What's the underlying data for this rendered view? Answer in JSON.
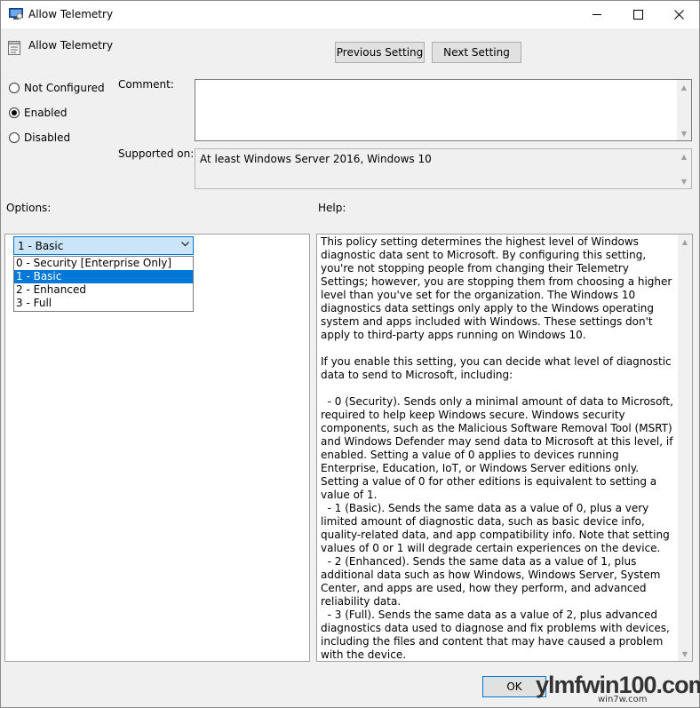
{
  "window": {
    "title": "Allow Telemetry"
  },
  "setting": {
    "name": "Allow Telemetry"
  },
  "nav": {
    "previous_label": "Previous Setting",
    "next_label": "Next Setting"
  },
  "state_options": [
    {
      "label": "Not Configured",
      "selected": false
    },
    {
      "label": "Enabled",
      "selected": true
    },
    {
      "label": "Disabled",
      "selected": false
    }
  ],
  "comment": {
    "label": "Comment:",
    "value": ""
  },
  "supported": {
    "label": "Supported on:",
    "value": "At least Windows Server 2016, Windows 10"
  },
  "options": {
    "label": "Options:",
    "combo_value": "1 - Basic",
    "items": [
      "0 - Security [Enterprise Only]",
      "1 - Basic",
      "2 - Enhanced",
      "3 - Full"
    ],
    "selected_index": 1
  },
  "help": {
    "label": "Help:",
    "text": "This policy setting determines the highest level of Windows diagnostic data sent to Microsoft. By configuring this setting, you're not stopping people from changing their Telemetry Settings; however, you are stopping them from choosing a higher level than you've set for the organization. The Windows 10 diagnostics data settings only apply to the Windows operating system and apps included with Windows. These settings don't apply to third-party apps running on Windows 10.\n\nIf you enable this setting, you can decide what level of diagnostic data to send to Microsoft, including:\n\n  - 0 (Security). Sends only a minimal amount of data to Microsoft, required to help keep Windows secure. Windows security components, such as the Malicious Software Removal Tool (MSRT) and Windows Defender may send data to Microsoft at this level, if enabled. Setting a value of 0 applies to devices running Enterprise, Education, IoT, or Windows Server editions only. Setting a value of 0 for other editions is equivalent to setting a value of 1.\n  - 1 (Basic). Sends the same data as a value of 0, plus a very limited amount of diagnostic data, such as basic device info, quality-related data, and app compatibility info. Note that setting values of 0 or 1 will degrade certain experiences on the device.\n  - 2 (Enhanced). Sends the same data as a value of 1, plus additional data such as how Windows, Windows Server, System Center, and apps are used, how they perform, and advanced reliability data.\n  - 3 (Full). Sends the same data as a value of 2, plus advanced diagnostics data used to diagnose and fix problems with devices, including the files and content that may have caused a problem with the device.\n\nIf you disable or don't configure this policy setting, telemetry settings can be configured individually in Settings."
  },
  "footer": {
    "ok_label": "OK"
  },
  "watermark": {
    "main": "ylmfwin100.com",
    "sub": "win7w.com"
  }
}
